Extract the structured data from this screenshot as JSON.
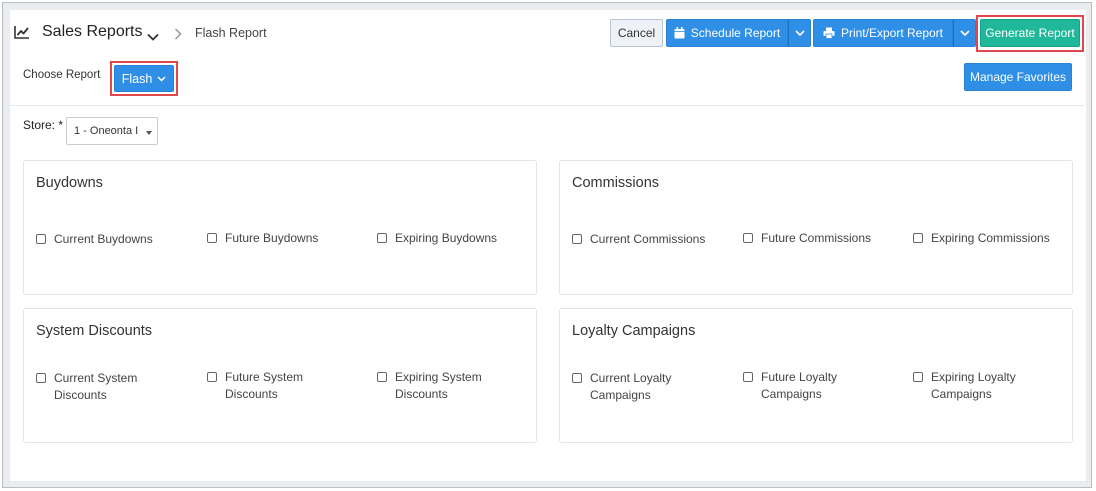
{
  "header": {
    "title": "Sales Reports",
    "breadcrumb": "Flash Report",
    "buttons": {
      "cancel": "Cancel",
      "schedule": "Schedule Report",
      "print_export": "Print/Export Report",
      "generate": "Generate Report"
    }
  },
  "toolbar": {
    "choose_report_label": "Choose Report",
    "report_type": "Flash",
    "manage_favorites": "Manage Favorites"
  },
  "store": {
    "label": "Store: *",
    "value": "1 - Oneonta I"
  },
  "panels": [
    {
      "title": "Buydowns",
      "options": [
        "Current Buydowns",
        "Future Buydowns",
        "Expiring Buydowns"
      ]
    },
    {
      "title": "Commissions",
      "options": [
        "Current Commissions",
        "Future Commissions",
        "Expiring Commissions"
      ]
    },
    {
      "title": "System Discounts",
      "options": [
        "Current System Discounts",
        "Future System Discounts",
        "Expiring System Discounts"
      ]
    },
    {
      "title": "Loyalty Campaigns",
      "options": [
        "Current Loyalty Campaigns",
        "Future Loyalty Campaigns",
        "Expiring Loyalty Campaigns"
      ]
    }
  ],
  "colors": {
    "primary": "#2f8fe6",
    "success": "#1fb89a",
    "highlight": "#e0474c"
  },
  "icons": {
    "title": "chart-line-icon",
    "schedule": "calendar-icon",
    "print": "printer-icon"
  }
}
